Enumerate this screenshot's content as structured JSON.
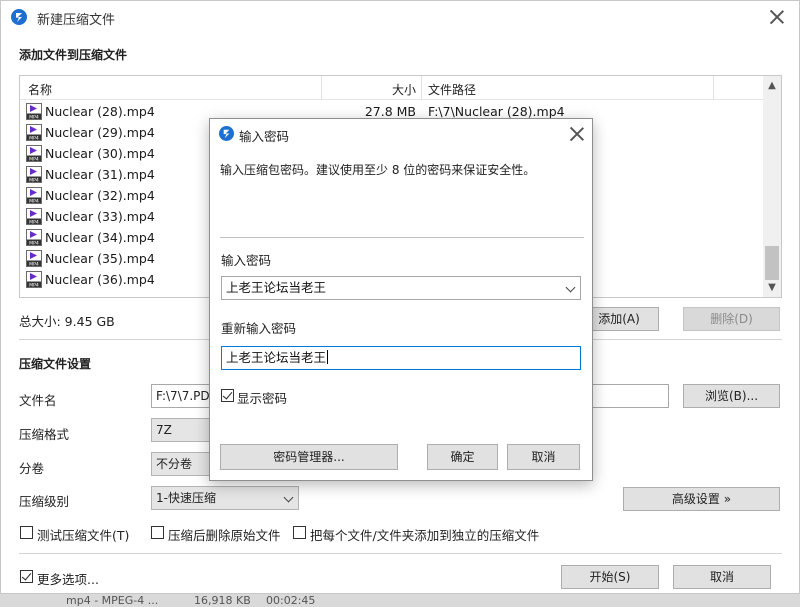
{
  "window": {
    "title": "新建压缩文件"
  },
  "add_files": {
    "section_title": "添加文件到压缩文件",
    "columns": [
      "名称",
      "大小",
      "文件路径"
    ],
    "files": [
      {
        "name": "Nuclear (28).mp4",
        "size": "27.8 MB",
        "path": "F:\\7\\Nuclear (28).mp4"
      },
      {
        "name": "Nuclear (29).mp4"
      },
      {
        "name": "Nuclear (30).mp4"
      },
      {
        "name": "Nuclear (31).mp4"
      },
      {
        "name": "Nuclear (32).mp4"
      },
      {
        "name": "Nuclear (33).mp4"
      },
      {
        "name": "Nuclear (34).mp4"
      },
      {
        "name": "Nuclear (35).mp4"
      },
      {
        "name": "Nuclear (36).mp4"
      }
    ],
    "total_size": "总大小: 9.45 GB",
    "add_button": "添加(A)",
    "delete_button": "删除(D)"
  },
  "settings": {
    "section_title": "压缩文件设置",
    "filename_label": "文件名",
    "filename_value": "F:\\7\\7.PD",
    "browse_button": "浏览(B)...",
    "format_label": "压缩格式",
    "format_value": "7Z",
    "split_label": "分卷",
    "split_value": "不分卷",
    "level_label": "压缩级别",
    "level_value": "1-快速压缩",
    "advanced_button": "高级设置 »",
    "options": [
      {
        "label": "测试压缩文件(T)",
        "checked": false
      },
      {
        "label": "压缩后删除原始文件",
        "checked": false
      },
      {
        "label": "把每个文件/文件夹添加到独立的压缩文件",
        "checked": false
      }
    ],
    "more_options": {
      "label": "更多选项...",
      "checked": true
    },
    "start_button": "开始(S)",
    "cancel_button": "取消"
  },
  "background_row": {
    "type": "mp4 - MPEG-4 ...",
    "size": "16,918 KB",
    "duration": "00:02:45"
  },
  "password_dialog": {
    "title": "输入密码",
    "description": "输入压缩包密码。建议使用至少 8 位的密码来保证安全性。",
    "password_label": "输入密码",
    "password_value": "上老王论坛当老王",
    "confirm_label": "重新输入密码",
    "confirm_value": "上老王论坛当老王",
    "show_password": {
      "label": "显示密码",
      "checked": true
    },
    "manager_button": "密码管理器...",
    "ok_button": "确定",
    "cancel_button": "取消"
  },
  "colors": {
    "accent": "#0078d7",
    "logo": "#1f6fd1",
    "mp4_icon": "#6a2cc9"
  }
}
